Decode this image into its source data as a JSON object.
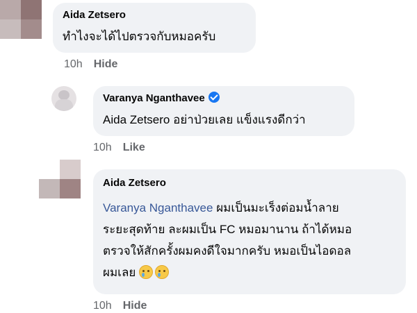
{
  "comments": [
    {
      "author": "Aida Zetsero",
      "text": "ทำไงจะได้ไปตรวจกับหมอครับ",
      "time": "10h",
      "action": "Hide",
      "avatar": "blurred-pixelated-avatar"
    },
    {
      "author": "Varanya Nganthavee",
      "verified": true,
      "text": "Aida Zetsero อย่าป่วยเลย แข็งแรงดีกว่า",
      "time": "10h",
      "action": "Like",
      "avatar": "profile-photo-avatar"
    },
    {
      "author": "Aida Zetsero",
      "mention": "Varanya Nganthavee",
      "lines": [
        " ผมเป็นมะเร็งต่อมน้ำลาย",
        "ระยะสุดท้าย ละผมเป็น FC หมอมานาน ถ้าได้หมอ",
        "ตรวจให้สักครั้งผมคงดีใจมากครับ หมอเป็นไอดอล",
        "ผมเลย"
      ],
      "emojis": [
        "crying-face-emoji",
        "crying-face-emoji"
      ],
      "time": "10h",
      "action": "Hide",
      "avatar": "blurred-pixelated-avatar"
    }
  ],
  "colors": {
    "bubble": "#f0f2f5",
    "text": "#050505",
    "meta": "#65676b",
    "mention": "#385898",
    "verified": "#1877f2"
  }
}
